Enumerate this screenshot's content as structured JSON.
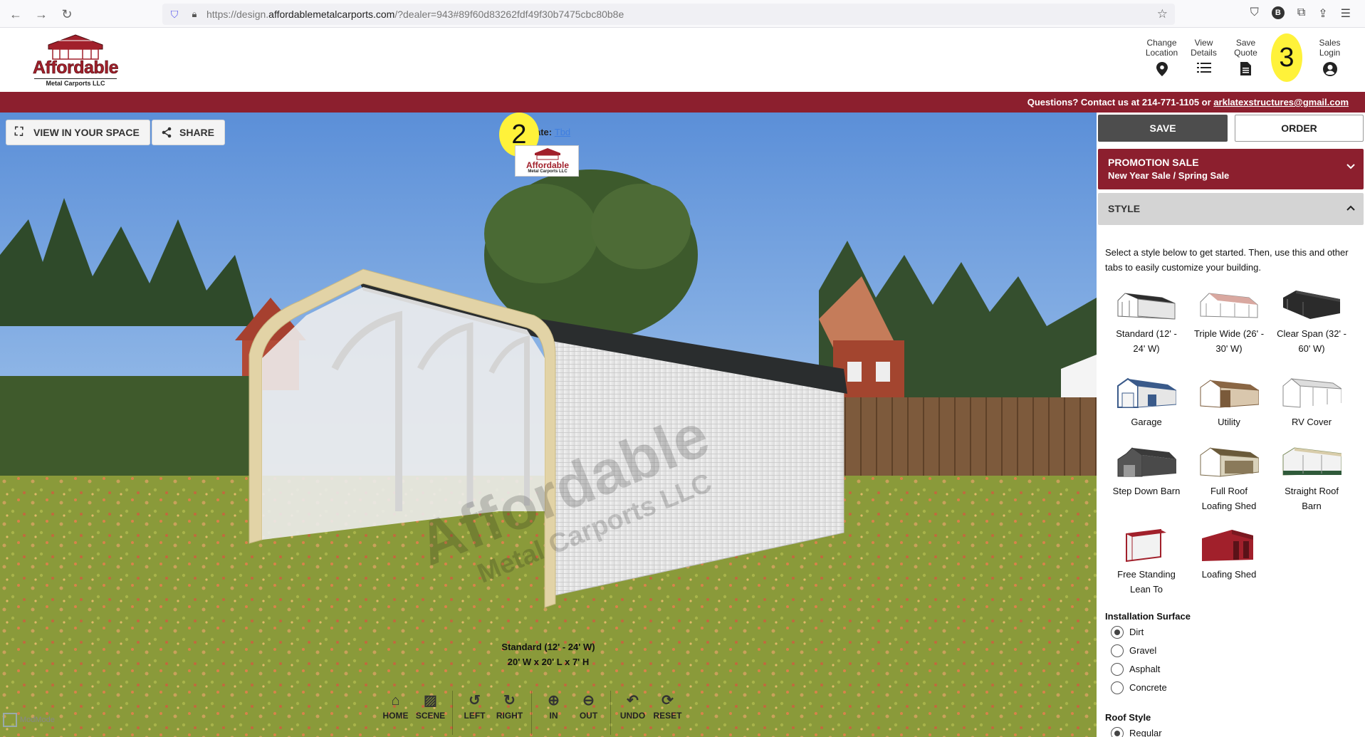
{
  "browser": {
    "url_prefix": "https://design.",
    "url_domain": "affordablemetalcarports.com",
    "url_rest": "/?dealer=943#89f60d83262fdf49f30b7475cbc80b8e",
    "profile_initial": "B"
  },
  "header": {
    "logo_word": "Affordable",
    "logo_sub": "Metal Carports LLC",
    "actions": [
      {
        "label_line1": "Change",
        "label_line2": "Location",
        "icon": "location-pin-icon"
      },
      {
        "label_line1": "View",
        "label_line2": "Details",
        "icon": "list-icon"
      },
      {
        "label_line1": "Save",
        "label_line2": "Quote",
        "icon": "document-icon"
      },
      {
        "label_line1": "",
        "label_line2": "",
        "icon": "hidden"
      },
      {
        "label_line1": "Sales",
        "label_line2": "Login",
        "icon": "user-circle-icon"
      }
    ]
  },
  "banner": {
    "text": "Questions? Contact us at 214-771-1105 or ",
    "email": "arklatexstructures@gmail.com",
    "color": "#8c1f2e"
  },
  "markers": {
    "marker2": "2",
    "marker3": "3"
  },
  "viewport": {
    "view_in_space": "VIEW IN YOUR SPACE",
    "share": "SHARE",
    "estimate_prefix": "ate:",
    "estimate_link": "Tbd",
    "mini_logo_word": "Affordable",
    "mini_logo_sub": "Metal Carports LLC",
    "watermark": "Affordable",
    "watermark_sub": "Metal Carports LLC",
    "caption_line1": "Standard (12' - 24' W)",
    "caption_line2": "20' W x 20' L x 7' H",
    "toolbar": [
      {
        "group": 1,
        "label": "HOME",
        "icon": "home-icon"
      },
      {
        "group": 1,
        "label": "SCENE",
        "icon": "image-icon"
      },
      {
        "group": 2,
        "label": "LEFT",
        "icon": "rotate-left-icon"
      },
      {
        "group": 2,
        "label": "RIGHT",
        "icon": "rotate-right-icon"
      },
      {
        "group": 3,
        "label": "IN",
        "icon": "zoom-in-icon"
      },
      {
        "group": 3,
        "label": "OUT",
        "icon": "zoom-out-icon"
      },
      {
        "group": 4,
        "label": "UNDO",
        "icon": "undo-icon"
      },
      {
        "group": 4,
        "label": "RESET",
        "icon": "reset-icon"
      }
    ],
    "corner_text": "ModMode"
  },
  "sidebar": {
    "save": "SAVE",
    "order": "ORDER",
    "promo_title": "PROMOTION SALE",
    "promo_sub": "New Year Sale / Spring Sale",
    "style_title": "STYLE",
    "intro": "Select a style below to get started. Then, use this and other tabs to easily customize your building.",
    "styles": [
      {
        "line1": "Standard (12' -",
        "line2": "24' W)"
      },
      {
        "line1": "Triple Wide (26' -",
        "line2": "30' W)"
      },
      {
        "line1": "Clear Span (32' -",
        "line2": "60' W)"
      },
      {
        "line1": "Garage",
        "line2": ""
      },
      {
        "line1": "Utility",
        "line2": ""
      },
      {
        "line1": "RV Cover",
        "line2": ""
      },
      {
        "line1": "Step Down Barn",
        "line2": ""
      },
      {
        "line1": "Full Roof",
        "line2": "Loafing Shed"
      },
      {
        "line1": "Straight Roof",
        "line2": "Barn"
      },
      {
        "line1": "Free Standing",
        "line2": "Lean To"
      },
      {
        "line1": "Loafing Shed",
        "line2": ""
      }
    ],
    "surface_title": "Installation Surface",
    "surfaces": [
      "Dirt",
      "Gravel",
      "Asphalt",
      "Concrete"
    ],
    "surface_selected": "Dirt",
    "roof_title": "Roof Style",
    "roof_first": "Regular"
  }
}
